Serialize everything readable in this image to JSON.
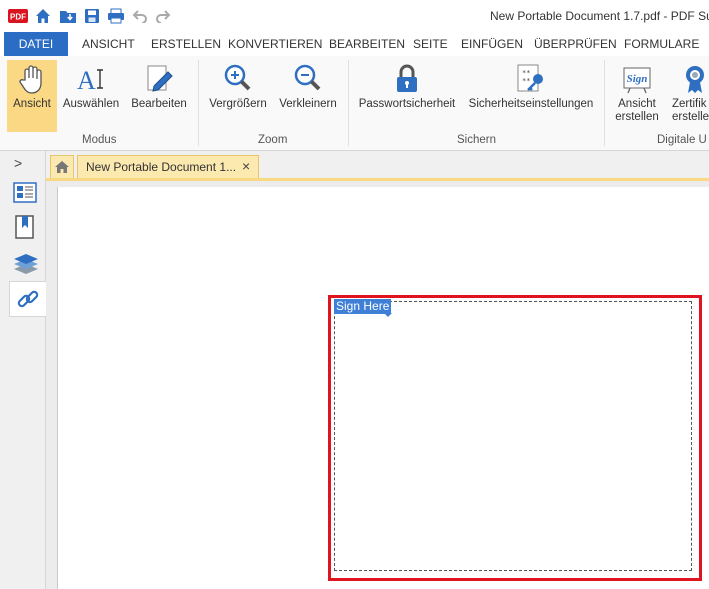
{
  "window": {
    "title": "New Portable Document 1.7.pdf   -   PDF Su"
  },
  "quick_access": [
    {
      "icon": "pdf-logo-icon",
      "label": "PDF"
    },
    {
      "icon": "home-icon"
    },
    {
      "icon": "open-folder-icon"
    },
    {
      "icon": "save-icon"
    },
    {
      "icon": "print-icon"
    },
    {
      "icon": "undo-icon"
    },
    {
      "icon": "redo-icon"
    }
  ],
  "menu": {
    "file": "DATEI",
    "items": [
      "ANSICHT",
      "ERSTELLEN",
      "KONVERTIEREN",
      "BEARBEITEN",
      "SEITE",
      "EINFÜGEN",
      "ÜBERPRÜFEN",
      "FORMULARE"
    ]
  },
  "ribbon": {
    "buttons": [
      {
        "label": "Ansicht",
        "icon": "hand-icon",
        "active": true
      },
      {
        "label": "Auswählen",
        "icon": "select-text-icon",
        "active": false
      },
      {
        "label": "Bearbeiten",
        "icon": "edit-pencil-icon",
        "active": false
      },
      {
        "label": "Vergrößern",
        "icon": "zoom-in-icon",
        "active": false
      },
      {
        "label": "Verkleinern",
        "icon": "zoom-out-icon",
        "active": false
      },
      {
        "label": "Passwortsicherheit",
        "icon": "padlock-icon",
        "active": false
      },
      {
        "label": "Sicherheitseinstellungen",
        "icon": "security-key-icon",
        "active": false
      },
      {
        "label_line1": "Ansicht",
        "label_line2": "erstellen",
        "icon": "sign-icon",
        "active": false
      },
      {
        "label_line1": "Zertifik",
        "label_line2": "erstelle",
        "icon": "certificate-icon",
        "active": false
      }
    ],
    "groups": [
      "Modus",
      "Zoom",
      "Sichern",
      "Digitale U"
    ]
  },
  "sidebar": {
    "toggle": ">",
    "icons": [
      "page-thumbnails-icon",
      "bookmarks-icon",
      "layers-icon",
      "links-icon"
    ]
  },
  "tabs": {
    "home_icon": "home-icon",
    "document_tab": "New Portable Document 1...",
    "close": "×"
  },
  "document": {
    "signature_field_label": "Sign Here"
  },
  "colors": {
    "accent_blue": "#2b6cc4",
    "active_yellow": "#fbd984",
    "highlight_red": "#e0141e",
    "sign_label_blue": "#3f7fd6"
  }
}
